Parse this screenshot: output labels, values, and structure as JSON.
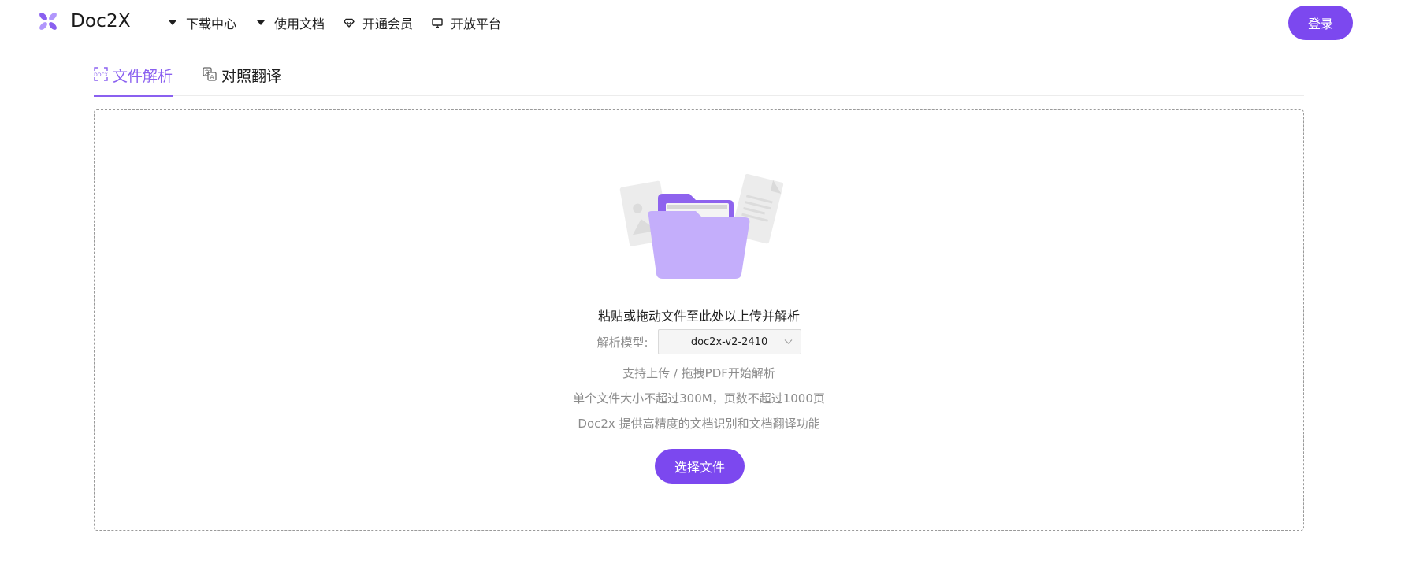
{
  "header": {
    "logo_text": "Doc2X",
    "logo_color": "#8a60f0",
    "nav": [
      {
        "label": "下载中心",
        "icon": "caret-down-icon"
      },
      {
        "label": "使用文档",
        "icon": "caret-down-icon"
      },
      {
        "label": "开通会员",
        "icon": "diamond-icon"
      },
      {
        "label": "开放平台",
        "icon": "monitor-icon"
      }
    ],
    "login_label": "登录"
  },
  "tabs": [
    {
      "label": "文件解析",
      "icon": "doc-scan-icon",
      "active": true
    },
    {
      "label": "对照翻译",
      "icon": "translate-icon",
      "active": false
    }
  ],
  "dropzone": {
    "illustration": "folder-with-documents-icon",
    "title": "粘贴或拖动文件至此处以上传并解析",
    "model_label": "解析模型:",
    "model_value": "doc2x-v2-2410",
    "info_lines": [
      "支持上传 / 拖拽PDF开始解析",
      "单个文件大小不超过300M，页数不超过1000页",
      "Doc2x 提供高精度的文档识别和文档翻译功能"
    ],
    "select_button": "选择文件"
  },
  "colors": {
    "accent": "#7c48ef",
    "tab_active": "#8a60f0",
    "muted_text": "#8c8c8c"
  }
}
